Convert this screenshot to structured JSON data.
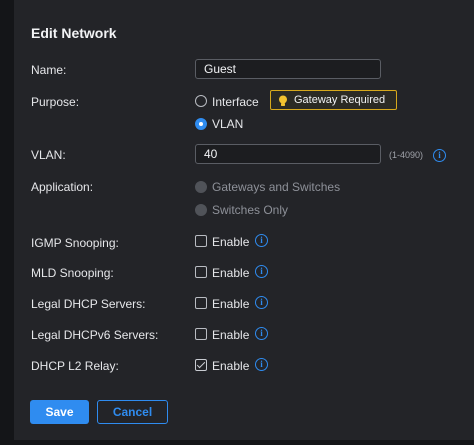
{
  "title": "Edit Network",
  "name": {
    "label": "Name:",
    "value": "Guest"
  },
  "purpose": {
    "label": "Purpose:",
    "options": [
      {
        "label": "Interface",
        "selected": false
      },
      {
        "label": "VLAN",
        "selected": true
      }
    ],
    "badge": "Gateway Required"
  },
  "vlan": {
    "label": "VLAN:",
    "value": "40",
    "hint": "(1-4090)"
  },
  "application": {
    "label": "Application:",
    "options": [
      {
        "label": "Gateways and Switches",
        "selected": false
      },
      {
        "label": "Switches Only",
        "selected": true
      }
    ]
  },
  "toggles": [
    {
      "label": "IGMP Snooping:",
      "option": "Enable",
      "checked": false
    },
    {
      "label": "MLD Snooping:",
      "option": "Enable",
      "checked": false
    },
    {
      "label": "Legal DHCP Servers:",
      "option": "Enable",
      "checked": false
    },
    {
      "label": "Legal DHCPv6 Servers:",
      "option": "Enable",
      "checked": false
    },
    {
      "label": "DHCP L2 Relay:",
      "option": "Enable",
      "checked": true
    }
  ],
  "info_glyph": "i",
  "buttons": {
    "save": "Save",
    "cancel": "Cancel"
  },
  "colors": {
    "accent": "#2f8cf0",
    "warning": "#d7a91c",
    "background": "#232428"
  }
}
